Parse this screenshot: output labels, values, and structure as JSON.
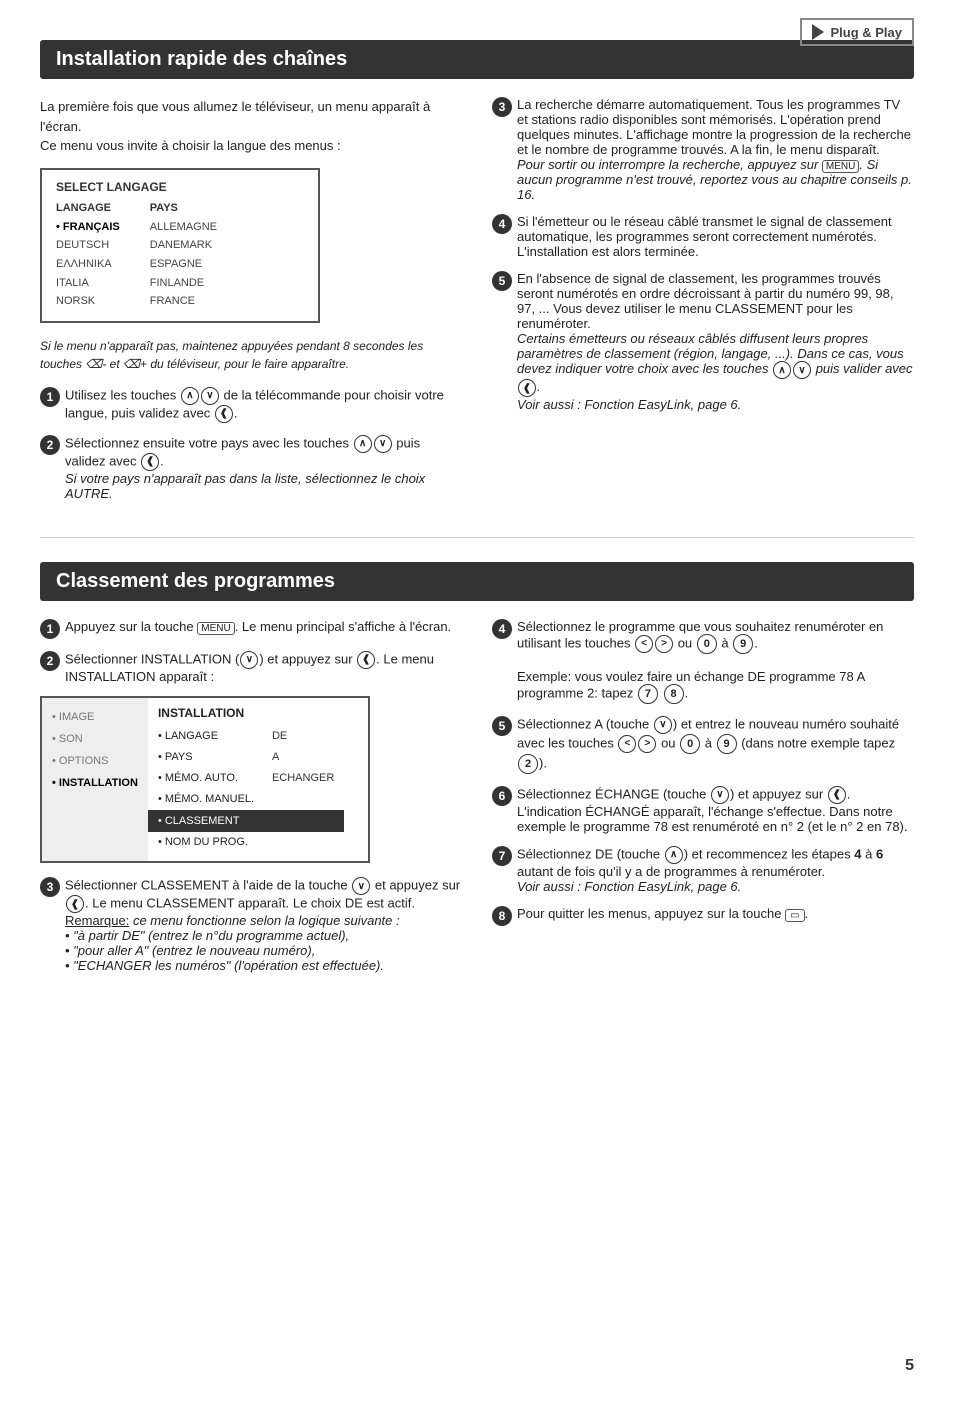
{
  "brand": {
    "name": "Plug & Play"
  },
  "section1": {
    "title": "Installation rapide des chaînes",
    "intro": [
      "La première fois que vous allumez le téléviseur, un menu apparaît à l'écran.",
      "Ce menu vous invite à choisir la langue des menus :"
    ],
    "select_langage_box": {
      "title": "SELECT LANGAGE",
      "col1_header": "LANGAGE",
      "col2_header": "PAYS",
      "col1_items": [
        "• FRANÇAIS",
        "DEUTSCH",
        "ΕΛΛΗΝΙΚΑ",
        "ITALIA",
        "NORSK"
      ],
      "col2_items": [
        "ALLEMAGNE",
        "DANEMARK",
        "ESPAGNE",
        "FINLANDE",
        "FRANCE"
      ]
    },
    "italic_note": "Si le menu n'apparaît pas, maintenez appuyées pendant 8 secondes les touches  - et  + du téléviseur, pour le faire apparaître.",
    "steps_left": [
      {
        "num": "1",
        "text": "Utilisez les touches",
        "text2": "de la télécommande pour choisir votre langue, puis validez avec",
        "note": ""
      },
      {
        "num": "2",
        "text": "Sélectionnez ensuite votre pays avec les touches",
        "text2": "puis validez avec",
        "italic": "Si votre pays n'apparaît pas dans la liste, sélectionnez le choix AUTRE."
      }
    ],
    "steps_right": [
      {
        "num": "3",
        "text": "La recherche démarre automatiquement. Tous les programmes TV et stations radio disponibles sont mémorisés. L'opération prend quelques minutes. L'affichage montre la progression de la recherche et le nombre de programme trouvés. A la fin, le menu disparaît.",
        "italic": "Pour sortir ou interrompre la recherche, appuyez sur . Si aucun programme n'est trouvé, reportez vous au chapitre conseils p. 16."
      },
      {
        "num": "4",
        "text": "Si l'émetteur ou le réseau câblé transmet le signal de classement automatique, les programmes seront correctement numérotés. L'installation est alors terminée."
      },
      {
        "num": "5",
        "text": "En l'absence de signal de classement, les programmes trouvés seront numérotés en ordre décroissant à partir du numéro 99, 98, 97, ... Vous devez utiliser le menu CLASSEMENT pour les renuméroter.",
        "italic": "Certains émetteurs ou réseaux câblés diffusent leurs propres paramètres de classement (région, langage, ...). Dans ce cas, vous devez indiquer votre choix avec les touches  puis valider avec . Voir aussi : Fonction EasyLink, page 6."
      }
    ]
  },
  "section2": {
    "title": "Classement des programmes",
    "steps_left": [
      {
        "num": "1",
        "text": "Appuyez sur la touche",
        "text2": ". Le menu principal s'affiche à l'écran."
      },
      {
        "num": "2",
        "text": "Sélectionner INSTALLATION (",
        "text2": ") et appuyez sur",
        "text3": ". Le menu INSTALLATION apparaît :"
      }
    ],
    "installation_box": {
      "left_items": [
        "• IMAGE",
        "• SON",
        "• OPTIONS",
        "• INSTALLATION"
      ],
      "title": "INSTALLATION",
      "menu_items": [
        {
          "label": "• LANGAGE",
          "value": "DE"
        },
        {
          "label": "• PAYS",
          "value": "A"
        },
        {
          "label": "• MÉMO. AUTO.",
          "value": "ECHANGER"
        },
        {
          "label": "• MÉMO. MANUEL.",
          "value": ""
        },
        {
          "label": "• CLASSEMENT",
          "value": "",
          "highlighted": true
        },
        {
          "label": "• NOM DU PROG.",
          "value": ""
        }
      ]
    },
    "step3": {
      "num": "3",
      "text": "Sélectionner CLASSEMENT à l'aide de la touche",
      "text2": "et appuyez sur",
      "text3": ". Le menu CLASSEMENT apparaît. Le choix DE est actif.",
      "underline": "Remarque:",
      "italic": "ce menu fonctionne selon la logique suivante :",
      "bullets": [
        "\"à partir DE\" (entrez le n°du programme actuel),",
        "\"pour aller A\" (entrez le nouveau numéro),",
        "\"ECHANGER les numéros\" (l'opération est effectuée)."
      ]
    },
    "steps_right": [
      {
        "num": "4",
        "text": "Sélectionnez le programme que vous souhaitez renuméroter en utilisant les touches",
        "text2": "ou",
        "text3": "à",
        "example": "Exemple: vous voulez faire un échange DE programme 78 A programme 2: tapez"
      },
      {
        "num": "5",
        "text": "Sélectionnez A (touche",
        "text2": ") et entrez le nouveau numéro souhaité avec les touches",
        "text3": "ou",
        "text4": "à",
        "text5": "(dans notre exemple tapez",
        "text6": ")."
      },
      {
        "num": "6",
        "text": "Sélectionnez ÉCHANGE (touche",
        "text2": ") et appuyez sur",
        "text3": ". L'indication ÉCHANGÉ apparaît, l'échange s'effectue. Dans notre exemple le programme 78 est renuméroté en n° 2 (et le n° 2 en 78)."
      },
      {
        "num": "7",
        "text": "Sélectionnez DE (touche",
        "text2": ") et recommencez les étapes",
        "text3": "à",
        "text4": "autant de fois qu'il y a de programmes à renuméroter.",
        "italic": "Voir aussi : Fonction EasyLink, page 6."
      },
      {
        "num": "8",
        "text": "Pour quitter les menus, appuyez sur la touche",
        "text2": "."
      }
    ]
  },
  "page_number": "5"
}
